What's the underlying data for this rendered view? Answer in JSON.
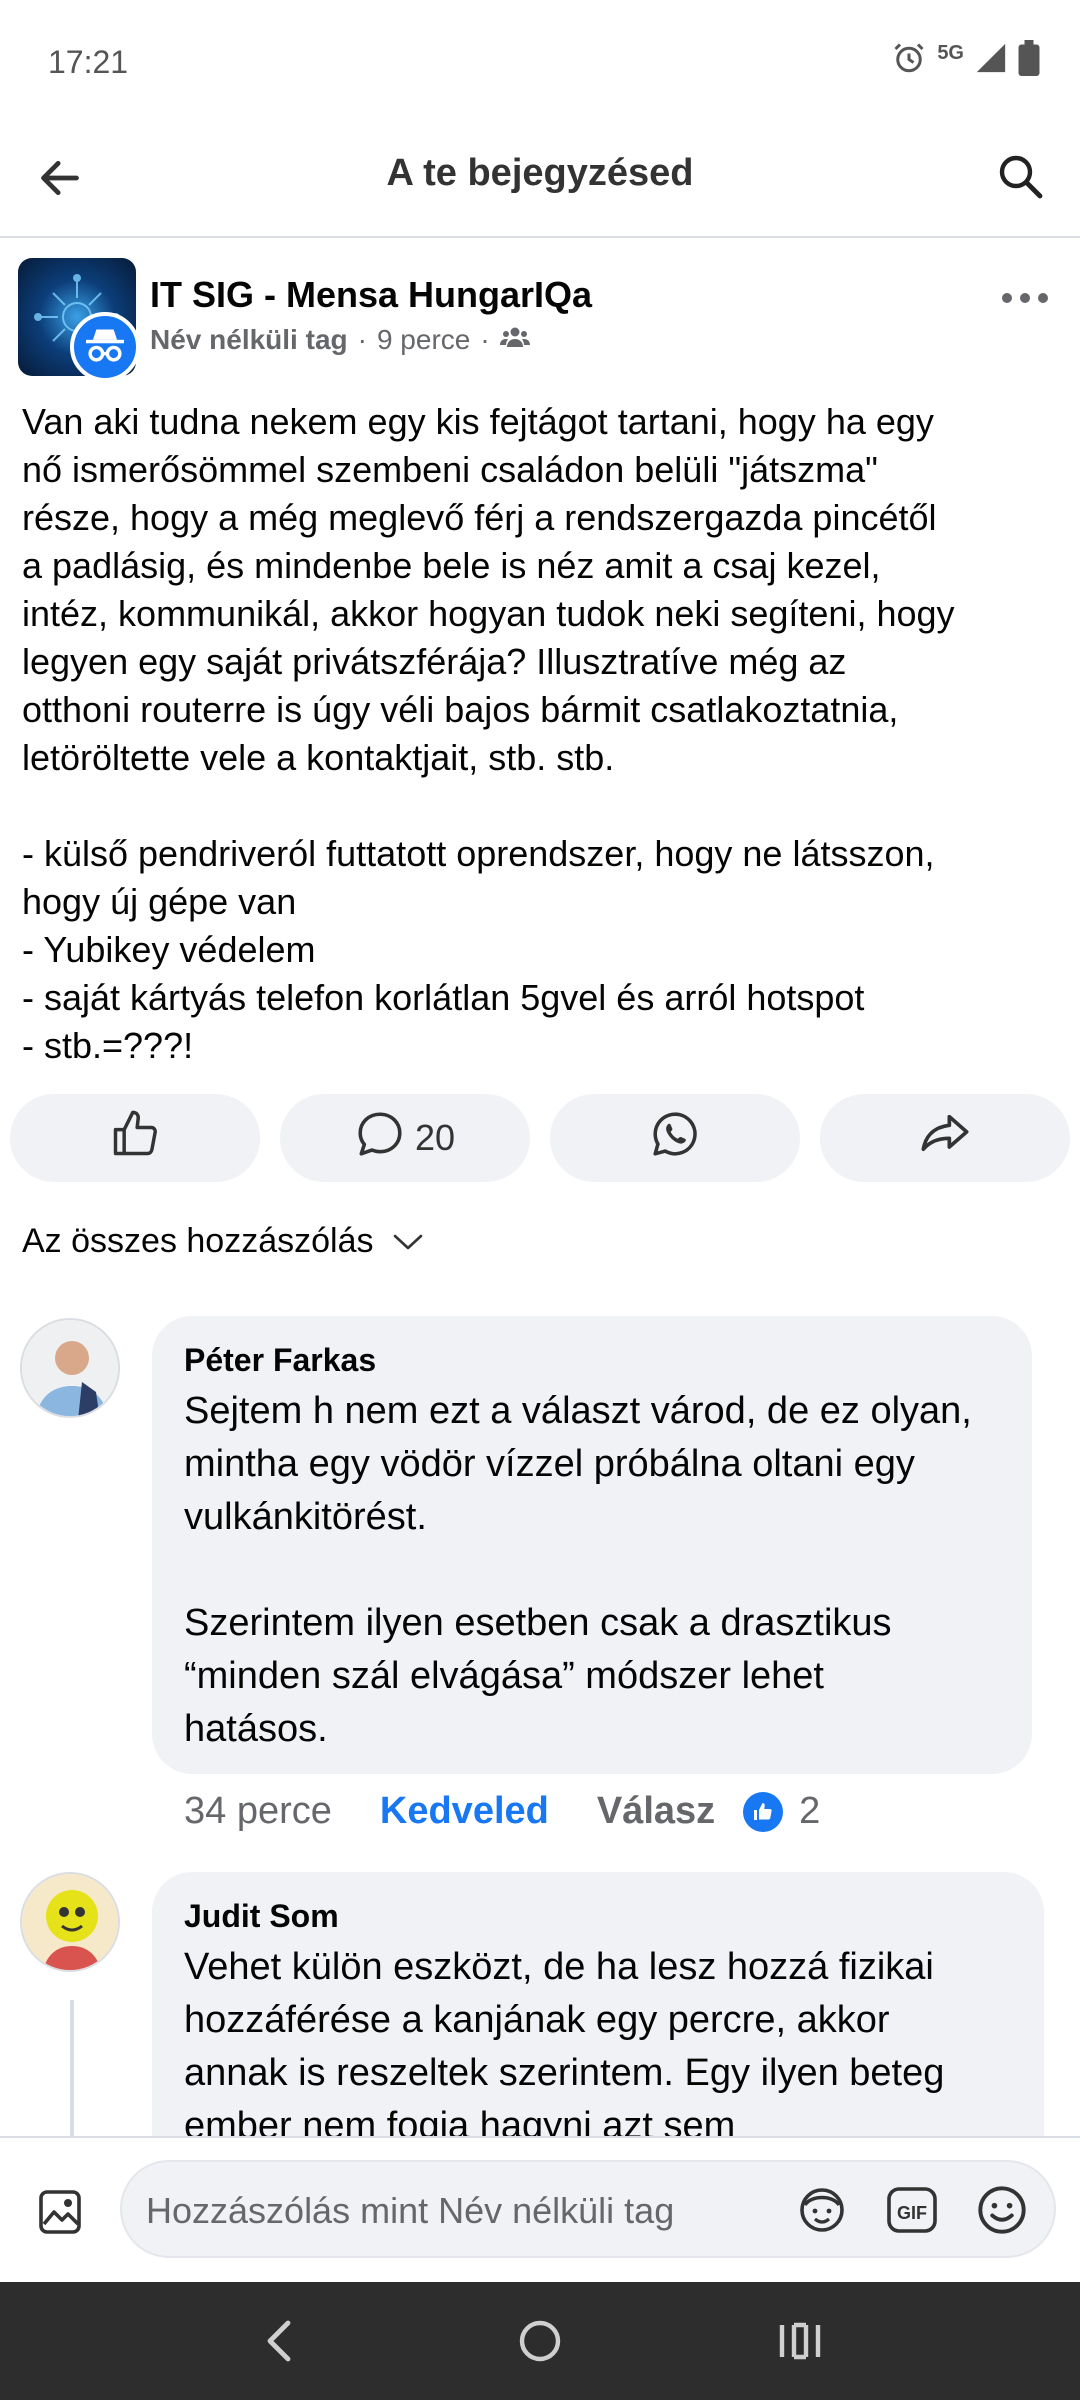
{
  "status": {
    "time": "17:21",
    "network": "5G"
  },
  "header": {
    "title": "A te bejegyzésed"
  },
  "post": {
    "group_name": "IT SIG - Mensa HungarIQa",
    "author": "Név nélküli tag",
    "time": "9 perce",
    "separator": "·",
    "body": "Van aki tudna nekem egy kis fejtágot tartani, hogy ha egy\nnő ismerősömmel szembeni családon belüli \"játszma\"\nrésze, hogy a még meglevő férj a rendszergazda pincétől\na padlásig, és mindenbe bele is néz amit a csaj kezel,\nintéz, kommunikál, akkor hogyan tudok neki segíteni, hogy\nlegyen egy saját privátszférája? Illusztratíve még az\notthoni routerre is úgy véli bajos bármit csatlakoztatnia,\nletöröltette vele a kontaktjait, stb. stb.\n\n- külső pendriveról futtatott oprendszer, hogy ne látsszon,\nhogy új gépe van\n- Yubikey védelem\n- saját kártyás telefon korlátlan 5gvel és arról hotspot\n- stb.=???!",
    "comment_count": "20"
  },
  "comments_filter": {
    "label": "Az összes hozzászólás"
  },
  "comments": [
    {
      "author": "Péter Farkas",
      "text": "Sejtem h nem ezt a választ várod, de ez olyan,\nmintha egy vödör vízzel próbálna oltani egy\nvulkánkitörést.\n\nSzerintem ilyen esetben csak a drasztikus\n“minden szál elvágása” módszer lehet\nhatásos.",
      "time": "34 perce",
      "like_label": "Kedveled",
      "reply_label": "Válasz",
      "likes": "2"
    },
    {
      "author": "Judit Som",
      "text": "Vehet külön eszközt, de ha lesz hozzá fizikai\nhozzáférése a kanjának egy percre, akkor\nannak is reszeltek szerintem. Egy ilyen beteg\nember nem fogja hagyni azt sem"
    }
  ],
  "composer": {
    "placeholder": "Hozzászólás mint Név nélküli tag"
  },
  "colors": {
    "accent": "#1877f2",
    "bubble": "#f0f2f5",
    "secondary_text": "#65676b",
    "nav_bar": "#2d2d2d"
  }
}
